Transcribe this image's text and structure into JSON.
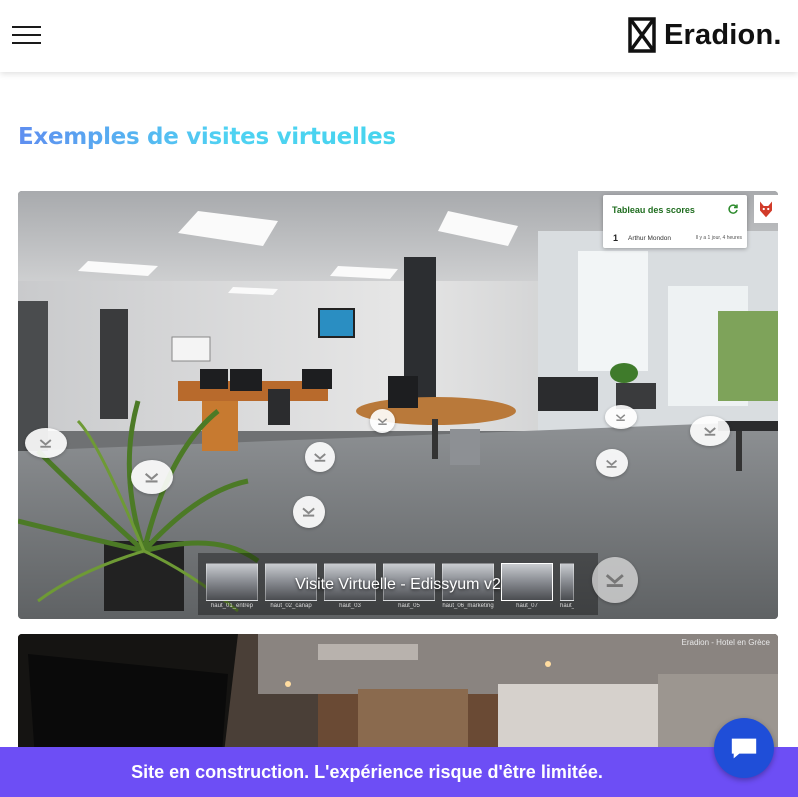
{
  "header": {
    "menu_icon": "hamburger-menu-icon",
    "logo_text": "Eradion."
  },
  "section": {
    "title": "Exemples de visites virtuelles"
  },
  "tour1": {
    "caption": "Visite Virtuelle - Edissyum v2",
    "scoreboard": {
      "title": "Tableau des scores",
      "refresh_icon": "refresh-icon",
      "entries": [
        {
          "rank": "1",
          "name": "Arthur Mondon",
          "time": "Il y a 1 jour, 4 heures"
        }
      ]
    },
    "thumbnails": [
      {
        "label": "haut_01_entrep"
      },
      {
        "label": "haut_02_canap"
      },
      {
        "label": "haut_03"
      },
      {
        "label": "haut_05"
      },
      {
        "label": "haut_06_marketing"
      },
      {
        "label": "haut_07"
      },
      {
        "label": "haut_"
      }
    ]
  },
  "tour2": {
    "label": "Eradion - Hotel en Grèce"
  },
  "banner": {
    "text": "Site en construction. L'expérience risque d'être limitée."
  },
  "chat": {
    "icon": "chat-bubble-icon"
  },
  "colors": {
    "banner": "#6d4ef5",
    "chat": "#1f4ed8",
    "title_start": "#5f8ef0",
    "title_end": "#46d4ee"
  }
}
